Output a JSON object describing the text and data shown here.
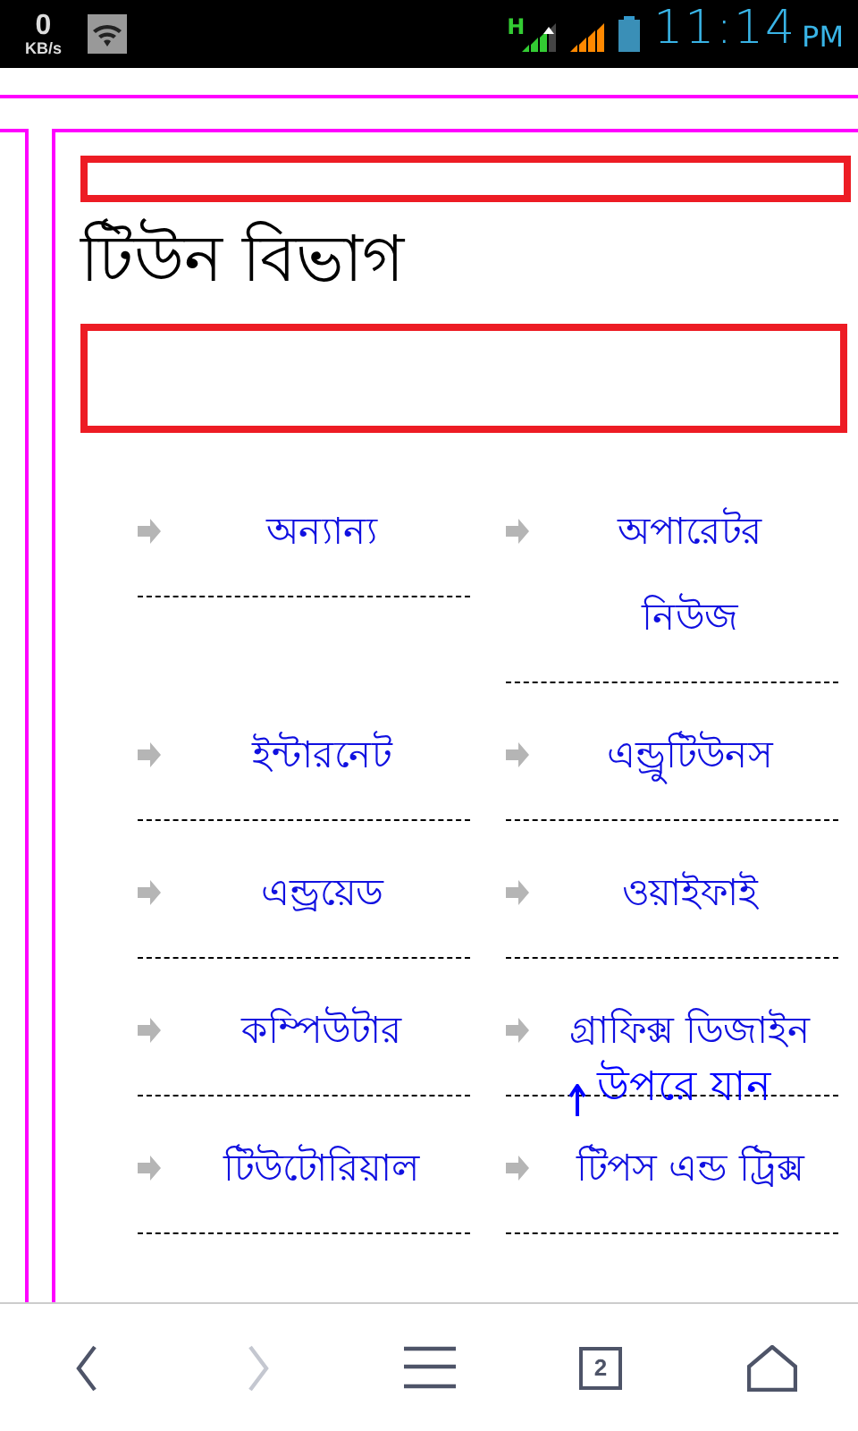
{
  "status_bar": {
    "speed": "0",
    "speed_unit": "KB/s",
    "network_type": "H",
    "time": "11:14",
    "time_suffix": "PM"
  },
  "section": {
    "title": "টিউন বিভাগ",
    "categories": [
      {
        "label": "অন্যান্য"
      },
      {
        "label": "অপারেটর নিউজ"
      },
      {
        "label": "ইন্টারনেট"
      },
      {
        "label": "এন্ড্রুটিউনস"
      },
      {
        "label": "এন্ড্রয়েড"
      },
      {
        "label": "ওয়াইফাই"
      },
      {
        "label": "কম্পিউটার"
      },
      {
        "label": "গ্রাফিক্স ডিজাইন"
      },
      {
        "label": "টিউটোরিয়াল"
      },
      {
        "label": "টিপস এন্ড ট্রিক্স"
      }
    ]
  },
  "back_to_top": {
    "label": "উপরে যান"
  },
  "toolbar": {
    "buttons": [
      {
        "kind": "back",
        "disabled": false
      },
      {
        "kind": "forward",
        "disabled": true
      },
      {
        "kind": "menu",
        "disabled": false
      },
      {
        "kind": "tabs",
        "disabled": false,
        "count": "2"
      },
      {
        "kind": "home",
        "disabled": false
      }
    ]
  }
}
